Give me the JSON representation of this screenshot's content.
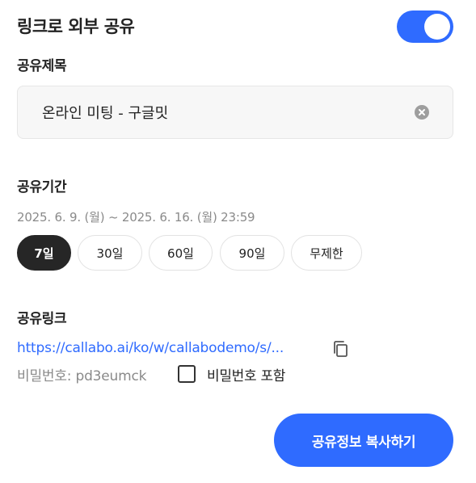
{
  "header": {
    "title": "링크로 외부 공유",
    "toggle_on": true
  },
  "share_title": {
    "label": "공유제목",
    "value": "온라인 미팅 - 구글밋"
  },
  "share_period": {
    "label": "공유기간",
    "range": "2025. 6. 9. (월) ~ 2025. 6. 16. (월) 23:59",
    "options": [
      "7일",
      "30일",
      "60일",
      "90일",
      "무제한"
    ],
    "selected": "7일"
  },
  "share_link": {
    "label": "공유링크",
    "url": "https://callabo.ai/ko/w/callabodemo/s/...",
    "password_text": "비밀번호: pd3eumck",
    "include_password_label": "비밀번호 포함",
    "include_password_checked": false
  },
  "actions": {
    "copy_button_label": "공유정보 복사하기"
  },
  "icons": {
    "clear": "clear-circle-icon",
    "copy": "copy-icon",
    "toggle": "toggle-switch"
  },
  "colors": {
    "accent": "#2f6bff",
    "chip_active": "#262626",
    "muted_text": "#8a8a8a"
  }
}
